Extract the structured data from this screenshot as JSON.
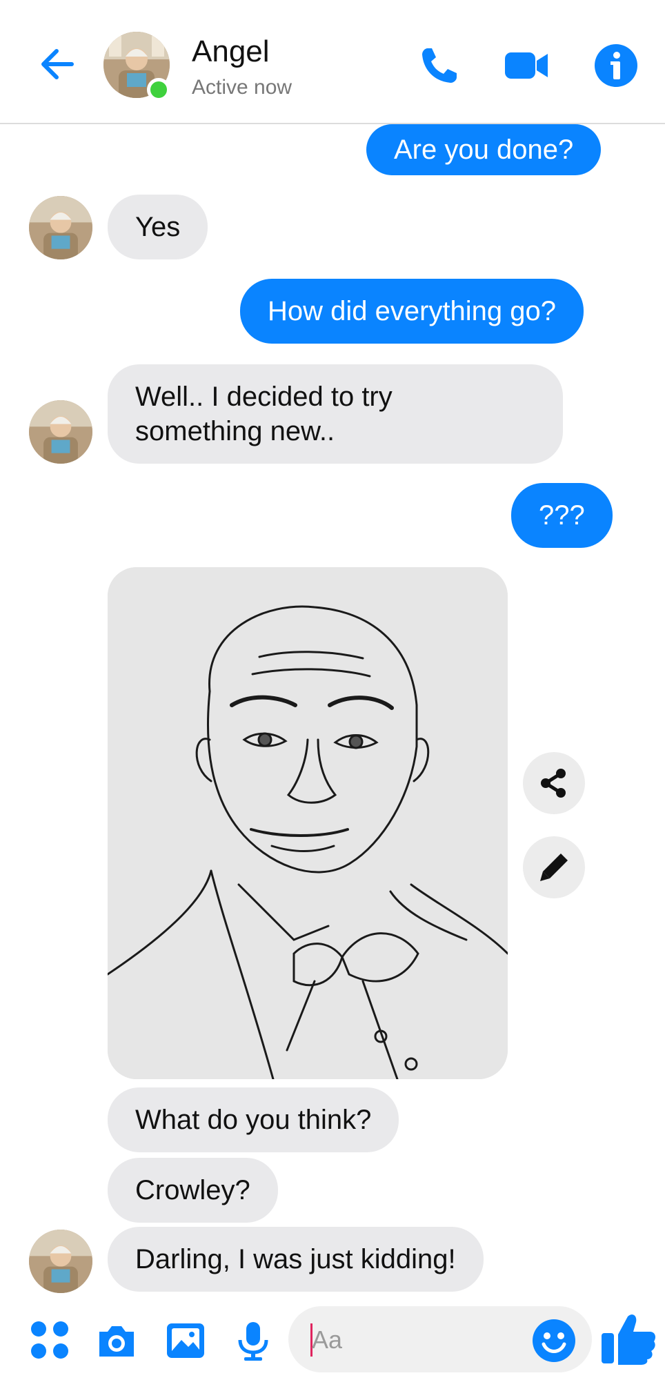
{
  "header": {
    "contact_name": "Angel",
    "status": "Active now",
    "back_icon": "back-arrow-icon",
    "call_icon": "phone-icon",
    "video_icon": "video-camera-icon",
    "info_icon": "info-icon"
  },
  "messages": [
    {
      "from": "me",
      "text": "Are you done?"
    },
    {
      "from": "them",
      "text": "Yes"
    },
    {
      "from": "me",
      "text": "How did everything go?"
    },
    {
      "from": "them",
      "text": "Well.. I decided to try something new.."
    },
    {
      "from": "me",
      "text": "???"
    },
    {
      "from": "them",
      "type": "image",
      "description_icon": "sketch-portrait-image"
    },
    {
      "from": "them",
      "text": "What do you think?"
    },
    {
      "from": "them",
      "text": "Crowley?"
    },
    {
      "from": "them",
      "text": "Darling, I was just kidding!"
    }
  ],
  "image_actions": {
    "share_icon": "share-icon",
    "edit_icon": "pencil-icon"
  },
  "composer": {
    "placeholder": "Aa",
    "icons": [
      "apps-icon",
      "camera-icon",
      "gallery-icon",
      "microphone-icon",
      "emoji-icon",
      "thumbs-up-icon"
    ]
  },
  "colors": {
    "accent": "#0a84ff",
    "incoming_bubble": "#e9e9eb",
    "online": "#3fd13d"
  }
}
